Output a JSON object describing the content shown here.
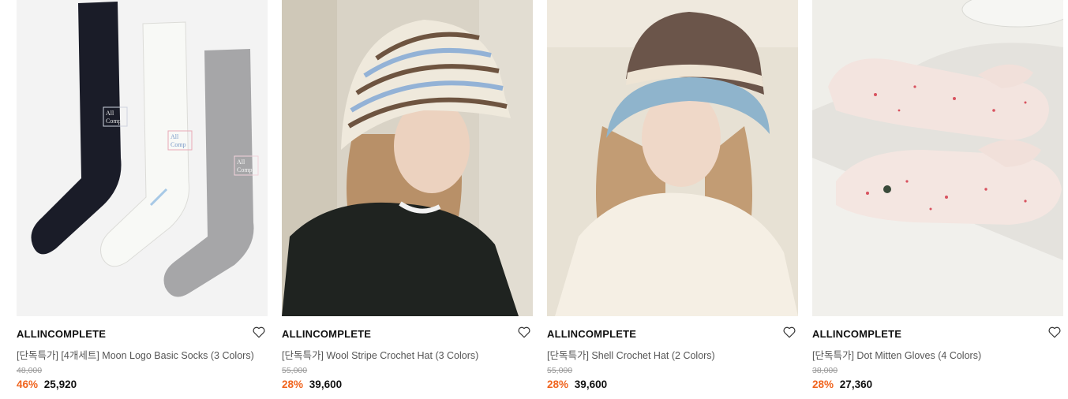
{
  "products": [
    {
      "brand": "ALLINCOMPLETE",
      "title": "[단독특가] [4개세트] Moon Logo Basic Socks (3 Colors)",
      "original_price": "48,000",
      "discount": "46%",
      "price": "25,920",
      "image": "socks-image",
      "wish_icon": "heart-outline-icon",
      "socks_logo_text": "All Comp"
    },
    {
      "brand": "ALLINCOMPLETE",
      "title": "[단독특가] Wool Stripe Crochet Hat (3 Colors)",
      "original_price": "55,000",
      "discount": "28%",
      "price": "39,600",
      "image": "striped-hat-model-image",
      "wish_icon": "heart-outline-icon"
    },
    {
      "brand": "ALLINCOMPLETE",
      "title": "[단독특가] Shell Crochet Hat (2 Colors)",
      "original_price": "55,000",
      "discount": "28%",
      "price": "39,600",
      "image": "shell-hat-model-image",
      "wish_icon": "heart-outline-icon"
    },
    {
      "brand": "ALLINCOMPLETE",
      "title": "[단독특가] Dot Mitten Gloves (4 Colors)",
      "original_price": "38,000",
      "discount": "28%",
      "price": "27,360",
      "image": "mitten-gloves-image",
      "wish_icon": "heart-outline-icon"
    }
  ],
  "colors": {
    "discount": "#f0641e",
    "brand_text": "#111111",
    "muted_text": "#999999"
  }
}
